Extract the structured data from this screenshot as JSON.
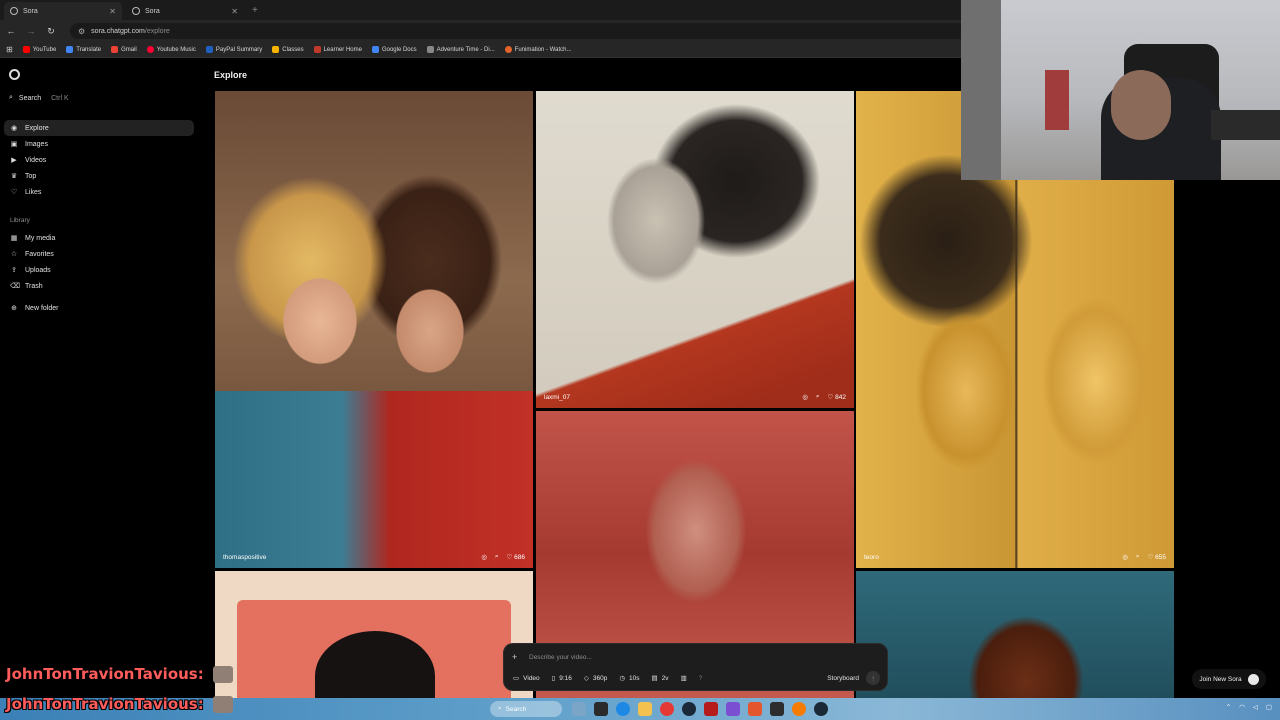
{
  "browser": {
    "tabs": [
      {
        "title": "Sora",
        "active": true
      },
      {
        "title": "Sora",
        "active": false
      }
    ],
    "url_domain": "sora.chatgpt.com",
    "url_path": "/explore",
    "bookmarks": [
      {
        "label": "YouTube",
        "color": "#ff0000"
      },
      {
        "label": "Translate",
        "color": "#4285f4"
      },
      {
        "label": "Gmail",
        "color": "#ea4335"
      },
      {
        "label": "Youtube Music",
        "color": "#ff0033"
      },
      {
        "label": "PayPal Summary",
        "color": "#1f5fbf"
      },
      {
        "label": "Classes",
        "color": "#f4b400"
      },
      {
        "label": "Learner Home",
        "color": "#c0392b"
      },
      {
        "label": "Google Docs",
        "color": "#4285f4"
      },
      {
        "label": "Adventure Time - Di...",
        "color": "#888888"
      },
      {
        "label": "Funimation - Watch...",
        "color": "#e3632a"
      }
    ]
  },
  "sidebar": {
    "search_label": "Search",
    "search_shortcut": "Ctrl K",
    "nav": [
      {
        "label": "Explore",
        "icon": "compass-icon",
        "glyph": "◉",
        "active": true
      },
      {
        "label": "Images",
        "icon": "image-icon",
        "glyph": "▣"
      },
      {
        "label": "Videos",
        "icon": "video-icon",
        "glyph": "▶"
      },
      {
        "label": "Top",
        "icon": "trophy-icon",
        "glyph": "♛"
      },
      {
        "label": "Likes",
        "icon": "heart-icon",
        "glyph": "♡"
      }
    ],
    "library_label": "Library",
    "library": [
      {
        "label": "My media",
        "icon": "media-icon",
        "glyph": "▦"
      },
      {
        "label": "Favorites",
        "icon": "star-icon",
        "glyph": "☆"
      },
      {
        "label": "Uploads",
        "icon": "upload-icon",
        "glyph": "⇪"
      },
      {
        "label": "Trash",
        "icon": "trash-icon",
        "glyph": "🗑"
      }
    ],
    "new_folder_label": "New folder"
  },
  "main": {
    "title": "Explore",
    "tiles": [
      {
        "author": "thomaspositive",
        "likes": "686"
      },
      {
        "author": "laxmi_07",
        "likes": "842"
      },
      {
        "author": "teoro",
        "likes": "655"
      }
    ]
  },
  "composer": {
    "placeholder": "Describe your video...",
    "type_label": "Video",
    "aspect_label": "9:16",
    "resolution_label": "360p",
    "duration_label": "10s",
    "variations_label": "2v",
    "help_label": "?",
    "storyboard_label": "Storyboard"
  },
  "join_label": "Join New Sora",
  "chat_overlay": {
    "username": "JohnTonTravionTavious:"
  },
  "taskbar": {
    "search_label": "Search"
  }
}
